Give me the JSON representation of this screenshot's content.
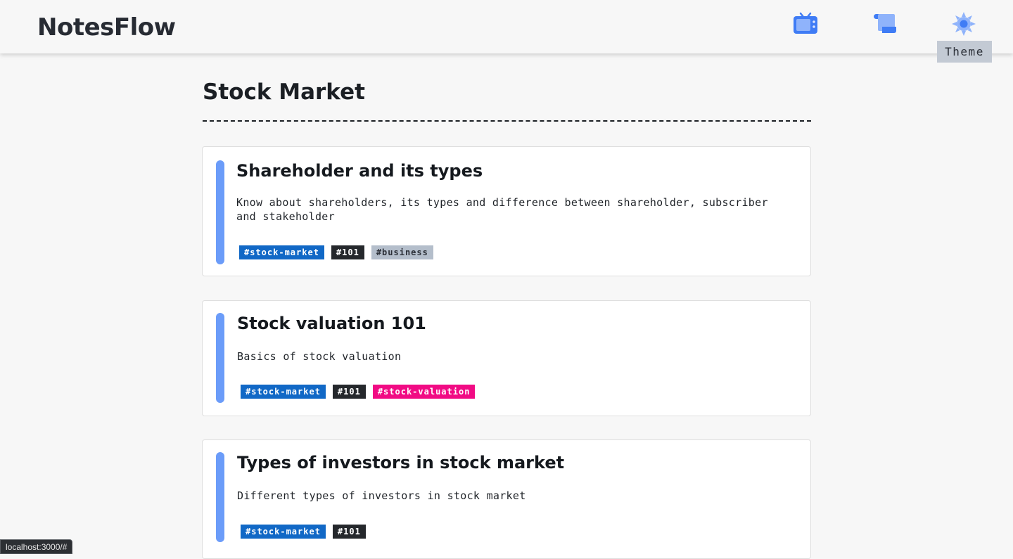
{
  "header": {
    "brand": "NotesFlow",
    "nav": [
      {
        "name": "tv-icon",
        "color": "#3f7cf5"
      },
      {
        "name": "scroll-icon",
        "color": "#3f7cf5"
      },
      {
        "name": "sun-icon",
        "color": "#3f7cf5"
      }
    ],
    "tooltip": "Theme"
  },
  "page": {
    "title": "Stock Market"
  },
  "notes": [
    {
      "title": "Shareholder and its types",
      "description": "Know about shareholders, its types and difference between shareholder, subscriber and stakeholder",
      "tags": [
        {
          "label": "#stock-market",
          "color": "#1168c6",
          "text_color": "#ffffff"
        },
        {
          "label": "#101",
          "color": "#25282c",
          "text_color": "#ffffff"
        },
        {
          "label": "#business",
          "color": "#b4becb",
          "text_color": "#2c3038"
        }
      ]
    },
    {
      "title": "Stock valuation 101",
      "description": "Basics of stock valuation",
      "tags": [
        {
          "label": "#stock-market",
          "color": "#1168c6",
          "text_color": "#ffffff"
        },
        {
          "label": "#101",
          "color": "#25282c",
          "text_color": "#ffffff"
        },
        {
          "label": "#stock-valuation",
          "color": "#f10b84",
          "text_color": "#ffffff"
        }
      ]
    },
    {
      "title": "Types of investors in stock market",
      "description": "Different types of investors in stock market",
      "tags": [
        {
          "label": "#stock-market",
          "color": "#1168c6",
          "text_color": "#ffffff"
        },
        {
          "label": "#101",
          "color": "#25282c",
          "text_color": "#ffffff"
        }
      ]
    }
  ],
  "status_bar": {
    "url": "localhost:3000/#"
  },
  "colors": {
    "accent_bar": "#6b9cf9",
    "background": "#f7f7f7"
  }
}
